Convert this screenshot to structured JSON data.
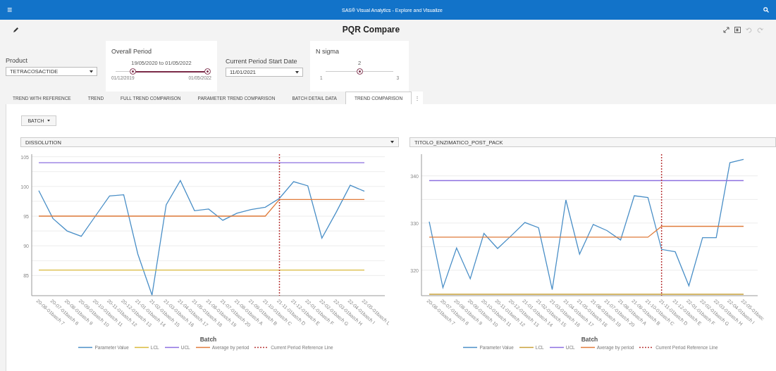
{
  "app_bar": {
    "menu_glyph": "≡",
    "title": "SAS® Visual Analytics - Explore and Visualize"
  },
  "report": {
    "title": "PQR Compare"
  },
  "controls": {
    "product": {
      "label": "Product",
      "value": "TETRACOSACTIDE"
    },
    "overall_period": {
      "label": "Overall Period",
      "range_text": "19/05/2020 to 01/05/2022",
      "min": "01/12/2019",
      "max": "01/05/2022",
      "handles": [
        {
          "level": 0.19
        },
        {
          "level": 1
        }
      ]
    },
    "current_period_start": {
      "label": "Current Period Start Date",
      "value": "11/01/2021"
    },
    "n_sigma": {
      "label": "N sigma",
      "value": "2",
      "min": "1",
      "max": "3",
      "level": 0.5
    }
  },
  "tabs": [
    {
      "label": "TREND WITH REFERENCE",
      "selected": false
    },
    {
      "label": "TREND",
      "selected": false
    },
    {
      "label": "FULL TREND COMPARISON",
      "selected": false
    },
    {
      "label": "PARAMETER TREND COMPARISON",
      "selected": false
    },
    {
      "label": "BATCH DETAIL DATA",
      "selected": false
    },
    {
      "label": "TREND COMPARISON",
      "selected": true
    }
  ],
  "tab_menu_glyph": "⋮",
  "group_by": {
    "value": "BATCH"
  },
  "charts": [
    {
      "parameter": "DISSOLUTION",
      "chart_data": {
        "type": "line",
        "xlabel": "Batch",
        "ylim": [
          81.6,
          105.2
        ],
        "yticks": [
          85,
          90,
          95,
          100,
          105
        ],
        "categories": [
          "20-06-01batch 7",
          "20-07-01batch 8",
          "20-08-01batch 9",
          "20-09-01batch 10",
          "20-10-01batch 11",
          "20-11-01batch 12",
          "20-12-01batch 13",
          "21-01-01batch 14",
          "21-02-01batch 15",
          "21-03-01batch 16",
          "21-04-01batch 17",
          "21-05-01batch 18",
          "21-06-01batch 19",
          "21-07-01batch 20",
          "21-08-01batch A",
          "21-09-01batch B",
          "21-10-01batch C",
          "21-11-01batch D",
          "21-12-01batch E",
          "22-01-01batch F",
          "22-02-01batch G",
          "22-03-01batch H",
          "22-04-01batch I",
          "22-05-01batch L"
        ],
        "series": [
          {
            "name": "Parameter Value",
            "color": "#4a8fc7",
            "values": [
              99.3,
              94.6,
              92.5,
              91.6,
              95.0,
              98.4,
              98.6,
              88.6,
              81.7,
              96.9,
              101.0,
              95.9,
              96.2,
              94.3,
              95.5,
              96.1,
              96.5,
              98.0,
              100.8,
              100.1,
              91.3,
              95.6,
              100.2,
              99.2
            ]
          },
          {
            "name": "LCL",
            "color": "#d9b93a",
            "values": [
              85.9,
              85.9,
              85.9,
              85.9,
              85.9,
              85.9,
              85.9,
              85.9,
              85.9,
              85.9,
              85.9,
              85.9,
              85.9,
              85.9,
              85.9,
              85.9,
              85.9,
              85.9,
              85.9,
              85.9,
              85.9,
              85.9,
              85.9,
              85.9
            ]
          },
          {
            "name": "UCL",
            "color": "#8c6fe0",
            "values": [
              104,
              104,
              104,
              104,
              104,
              104,
              104,
              104,
              104,
              104,
              104,
              104,
              104,
              104,
              104,
              104,
              104,
              104,
              104,
              104,
              104,
              104,
              104,
              104
            ]
          },
          {
            "name": "Average by period",
            "color": "#e07b3a",
            "values": [
              95,
              95,
              95,
              95,
              95,
              95,
              95,
              95,
              95,
              95,
              95,
              95,
              95,
              95,
              95,
              95,
              95,
              97.8,
              97.8,
              97.8,
              97.8,
              97.8,
              97.8,
              97.8
            ]
          }
        ],
        "grid": true,
        "ref_lines": [
          {
            "axis": "x",
            "value": "21-11-01batch D",
            "label": "Current Period Reference Line",
            "color": "#b83838"
          }
        ]
      }
    },
    {
      "parameter": "TITOLO_ENZIMATICO_POST_PACK",
      "chart_data": {
        "type": "line",
        "xlabel": "Batch",
        "ylim": [
          314.6,
          344.3
        ],
        "yticks": [
          320,
          330,
          340
        ],
        "categories": [
          "20-06-01batch 7",
          "20-07-01batch 8",
          "20-08-01batch 9",
          "20-09-01batch 10",
          "20-10-01batch 11",
          "20-11-01batch 12",
          "20-12-01batch 13",
          "21-01-01batch 14",
          "21-02-01batch 15",
          "21-03-01batch 16",
          "21-04-01batch 17",
          "21-05-01batch 18",
          "21-06-01batch 19",
          "21-07-01batch 20",
          "21-08-01batch A",
          "21-09-01batch B",
          "21-10-01batch C",
          "21-11-01batch D",
          "21-12-01batch E",
          "22-01-01batch F",
          "22-02-01batch G",
          "22-03-01batch H",
          "22-04-01batch I",
          "22-05-01batc"
        ],
        "series": [
          {
            "name": "Parameter Value",
            "color": "#4a8fc7",
            "values": [
              330.3,
              316.3,
              324.7,
              318.2,
              327.8,
              324.6,
              327.3,
              330.1,
              329.0,
              315.9,
              334.9,
              323.4,
              329.7,
              328.4,
              326.4,
              335.8,
              335.4,
              324.4,
              323.9,
              316.7,
              326.9,
              326.9,
              342.8,
              343.5
            ]
          },
          {
            "name": "LCL",
            "color": "#c9a13a",
            "values": [
              314.9,
              314.9,
              314.9,
              314.9,
              314.9,
              314.9,
              314.9,
              314.9,
              314.9,
              314.9,
              314.9,
              314.9,
              314.9,
              314.9,
              314.9,
              314.9,
              314.9,
              314.9,
              314.9,
              314.9,
              314.9,
              314.9,
              314.9,
              314.9
            ]
          },
          {
            "name": "UCL",
            "color": "#8c6fe0",
            "values": [
              339,
              339,
              339,
              339,
              339,
              339,
              339,
              339,
              339,
              339,
              339,
              339,
              339,
              339,
              339,
              339,
              339,
              339,
              339,
              339,
              339,
              339,
              339,
              339
            ]
          },
          {
            "name": "Average by period",
            "color": "#e07b3a",
            "values": [
              327,
              327,
              327,
              327,
              327,
              327,
              327,
              327,
              327,
              327,
              327,
              327,
              327,
              327,
              327,
              327,
              327,
              329.3,
              329.3,
              329.3,
              329.3,
              329.3,
              329.3,
              329.3
            ]
          }
        ],
        "grid": true,
        "ref_lines": [
          {
            "axis": "x",
            "value": "21-11-01batch D",
            "label": "Current Period Reference Line",
            "color": "#b83838"
          }
        ]
      }
    }
  ]
}
